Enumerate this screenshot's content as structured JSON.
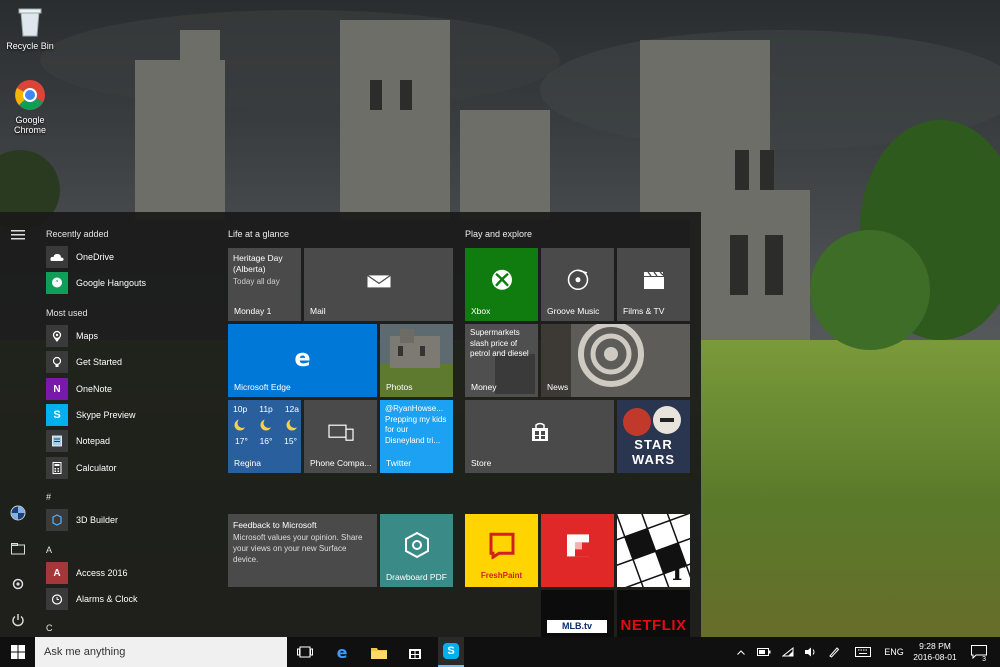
{
  "desktop": {
    "icons": [
      {
        "label": "Recycle Bin"
      },
      {
        "label": "Google Chrome"
      }
    ]
  },
  "start": {
    "recently_added_heading": "Recently added",
    "recent": [
      {
        "label": "OneDrive",
        "icon": "onedrive-icon"
      },
      {
        "label": "Google Hangouts",
        "icon": "hangouts-icon"
      }
    ],
    "most_used_heading": "Most used",
    "most_used": [
      {
        "label": "Maps",
        "icon": "maps-icon"
      },
      {
        "label": "Get Started",
        "icon": "lightbulb-icon"
      },
      {
        "label": "OneNote",
        "icon": "onenote-icon"
      },
      {
        "label": "Skype Preview",
        "icon": "skype-icon"
      },
      {
        "label": "Notepad",
        "icon": "notepad-icon"
      },
      {
        "label": "Calculator",
        "icon": "calculator-icon"
      }
    ],
    "hash_heading": "#",
    "hash_items": [
      {
        "label": "3D Builder",
        "icon": "3d-builder-icon"
      }
    ],
    "a_heading": "A",
    "a_items": [
      {
        "label": "Access 2016",
        "icon": "access-icon"
      },
      {
        "label": "Alarms & Clock",
        "icon": "alarm-clock-icon"
      }
    ],
    "c_heading": "C"
  },
  "tiles": {
    "group1_title": "Life at a glance",
    "group2_title": "Play and explore",
    "calendar": {
      "event": "Heritage Day (Alberta)",
      "time": "Today all day",
      "label": "Monday 1"
    },
    "mail": {
      "label": "Mail"
    },
    "edge": {
      "label": "Microsoft Edge"
    },
    "photos": {
      "label": "Photos"
    },
    "weather": {
      "hours": [
        {
          "time": "10p",
          "temp": "17°"
        },
        {
          "time": "11p",
          "temp": "16°"
        },
        {
          "time": "12a",
          "temp": "15°"
        }
      ],
      "label": "Regina"
    },
    "phone": {
      "label": "Phone Compa..."
    },
    "twitter": {
      "text": "@RyanHowse... Prepping my kids for our Disneyland tri...",
      "label": "Twitter"
    },
    "xbox": {
      "label": "Xbox"
    },
    "groove": {
      "label": "Groove Music"
    },
    "films": {
      "label": "Films & TV"
    },
    "money": {
      "text": "Supermarkets slash price of petrol and diesel",
      "label": "Money"
    },
    "news": {
      "label": "News"
    },
    "store": {
      "label": "Store"
    },
    "starwars": {
      "text": "STAR WARS"
    },
    "feedback": {
      "title": "Feedback to Microsoft",
      "text": "Microsoft values your opinion. Share your views on your new Surface device."
    },
    "drawboard": {
      "label": "Drawboard PDF"
    },
    "freshpaint": {
      "label": "FreshPaint"
    },
    "mlb": {
      "text": "MLB.tv"
    },
    "netflix": {
      "text": "NETFLIX"
    }
  },
  "taskbar": {
    "search_placeholder": "Ask me anything",
    "language": "ENG",
    "time": "9:28 PM",
    "date": "2016-08-01",
    "notification_count": "3"
  },
  "colors": {
    "accent": "#0078d7",
    "xbox": "#107c10",
    "onenote": "#7719aa",
    "access": "#a4373a",
    "flipboard": "#e12828",
    "freshpaint": "#ffd400",
    "netflix": "#e50914",
    "drawboard": "#3a8a88",
    "tile_gray": "#4a4a4a"
  }
}
